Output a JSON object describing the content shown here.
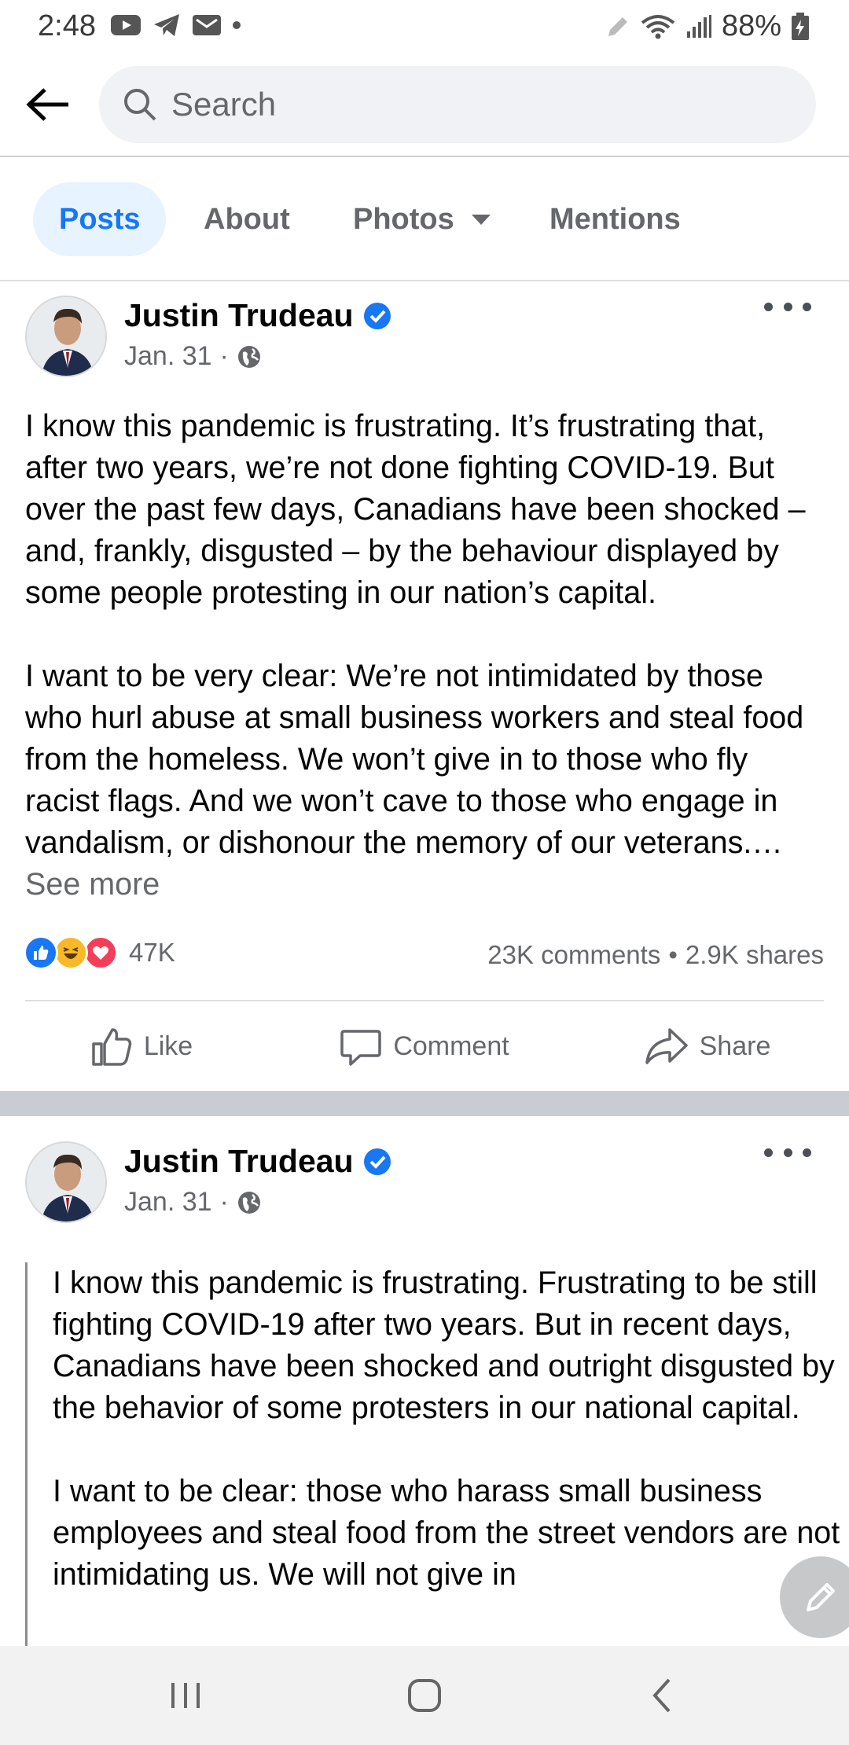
{
  "status_bar": {
    "time": "2:48",
    "battery": "88%",
    "left_icons": [
      "youtube-icon",
      "telegram-icon",
      "mail-icon",
      "dot-icon"
    ],
    "right_icons": [
      "pen-icon",
      "wifi-icon",
      "signal-icon",
      "battery-icon"
    ]
  },
  "search": {
    "placeholder": "Search"
  },
  "tabs": [
    {
      "label": "Posts",
      "active": true
    },
    {
      "label": "About",
      "active": false
    },
    {
      "label": "Photos",
      "active": false
    },
    {
      "label": "Mentions",
      "active": false
    }
  ],
  "posts": [
    {
      "author": "Justin Trudeau",
      "date": "Jan. 31",
      "audience": "globe-icon",
      "body": [
        "I know this pandemic is frustrating. It’s frustrating that, after two years, we’re not done fighting COVID-19. But over the past few days, Canadians have been shocked – and, frankly, disgusted – by the behaviour displayed by some people protesting in our nation’s capital.",
        "I want to be very clear: We’re not intimidated by those who hurl abuse at small business workers and steal food from the homeless. We won’t give in to those who fly racist flags. And we won’t cave to those who engage in vandalism, or dishonour the memory of our veterans.…"
      ],
      "see_more": "See more",
      "reaction_count": "47K",
      "comments": "23K comments",
      "shares": "2.9K shares",
      "actions": {
        "like": "Like",
        "comment": "Comment",
        "share": "Share"
      }
    },
    {
      "author": "Justin Trudeau",
      "date": "Jan. 31",
      "audience": "globe-icon",
      "body": [
        "I know this pandemic is frustrating. Frustrating to be still fighting COVID-19 after two years. But in recent days, Canadians have been shocked and outright disgusted by the behavior of some protesters in our national capital.",
        "I want to be clear: those who harass small business employees and steal food from the street vendors are not intimidating us. We will not give in"
      ]
    }
  ],
  "colors": {
    "accent": "#1877f2",
    "tab_active_bg": "#e7f3ff",
    "secondary_text": "#65676b",
    "separator": "#c9ccd1"
  }
}
